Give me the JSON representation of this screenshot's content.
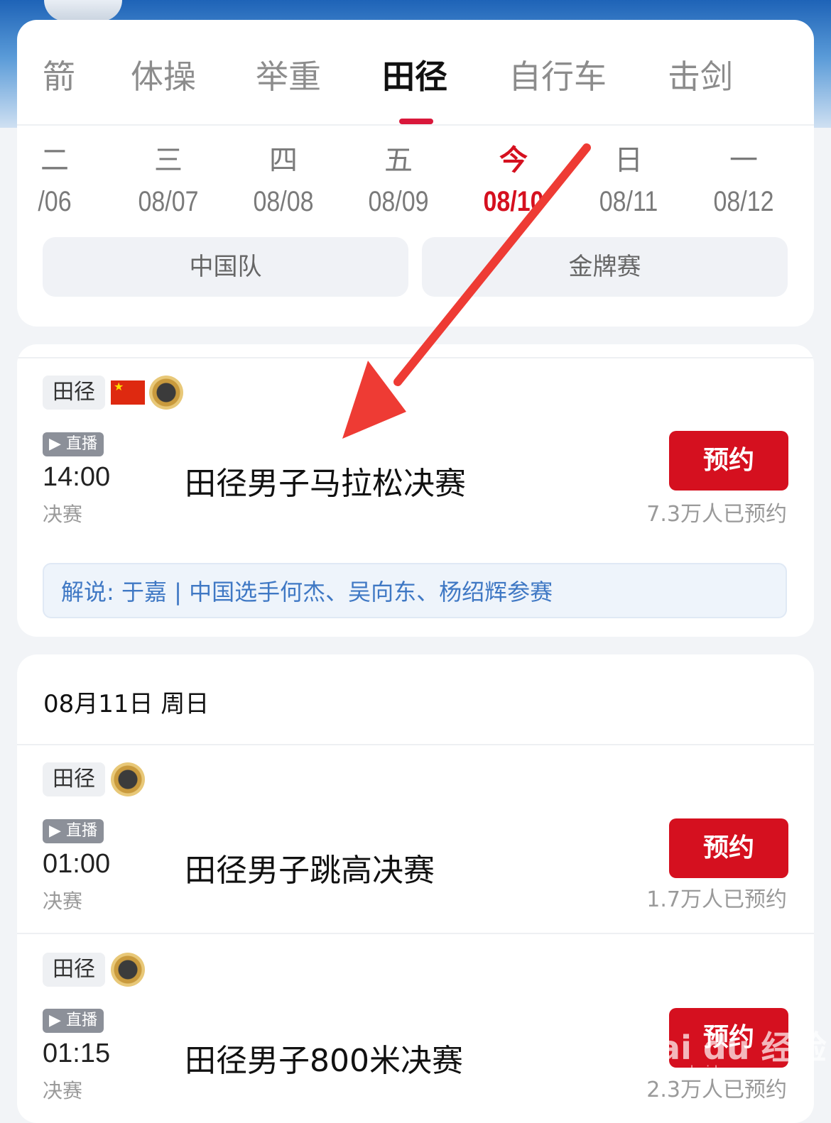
{
  "sport_tabs": [
    {
      "label": "箭"
    },
    {
      "label": "体操"
    },
    {
      "label": "举重"
    },
    {
      "label": "田径",
      "active": true
    },
    {
      "label": "自行车"
    },
    {
      "label": "击剑"
    }
  ],
  "days": [
    {
      "weekday": "二",
      "date": "/06"
    },
    {
      "weekday": "三",
      "date": "08/07"
    },
    {
      "weekday": "四",
      "date": "08/08"
    },
    {
      "weekday": "五",
      "date": "08/09"
    },
    {
      "weekday": "今",
      "date": "08/10",
      "today": true
    },
    {
      "weekday": "日",
      "date": "08/11"
    },
    {
      "weekday": "一",
      "date": "08/12"
    }
  ],
  "filters": {
    "china_team": "中国队",
    "gold_medal": "金牌赛"
  },
  "events": [
    {
      "sport": "田径",
      "live": "直播",
      "time": "14:00",
      "stage": "决赛",
      "title": "田径男子马拉松决赛",
      "button": "预约",
      "count": "7.3万人已预约",
      "commentary": "解说: 于嘉 | 中国选手何杰、吴向东、杨绍辉参赛"
    },
    {
      "sport": "田径",
      "live": "直播",
      "time": "01:00",
      "stage": "决赛",
      "title": "田径男子跳高决赛",
      "button": "预约",
      "count": "1.7万人已预约"
    },
    {
      "sport": "田径",
      "live": "直播",
      "time": "01:15",
      "stage": "决赛",
      "title": "田径男子800米决赛",
      "button": "预约",
      "count": "2.3万人已预约"
    }
  ],
  "date_header": "08月11日 周日",
  "watermark": {
    "text": "Bai du 经验",
    "sub": "jingyan.baidu.com"
  },
  "colors": {
    "accent": "#d5101f",
    "tab_underline": "#d9183b",
    "commentary_text": "#3f78c4"
  }
}
